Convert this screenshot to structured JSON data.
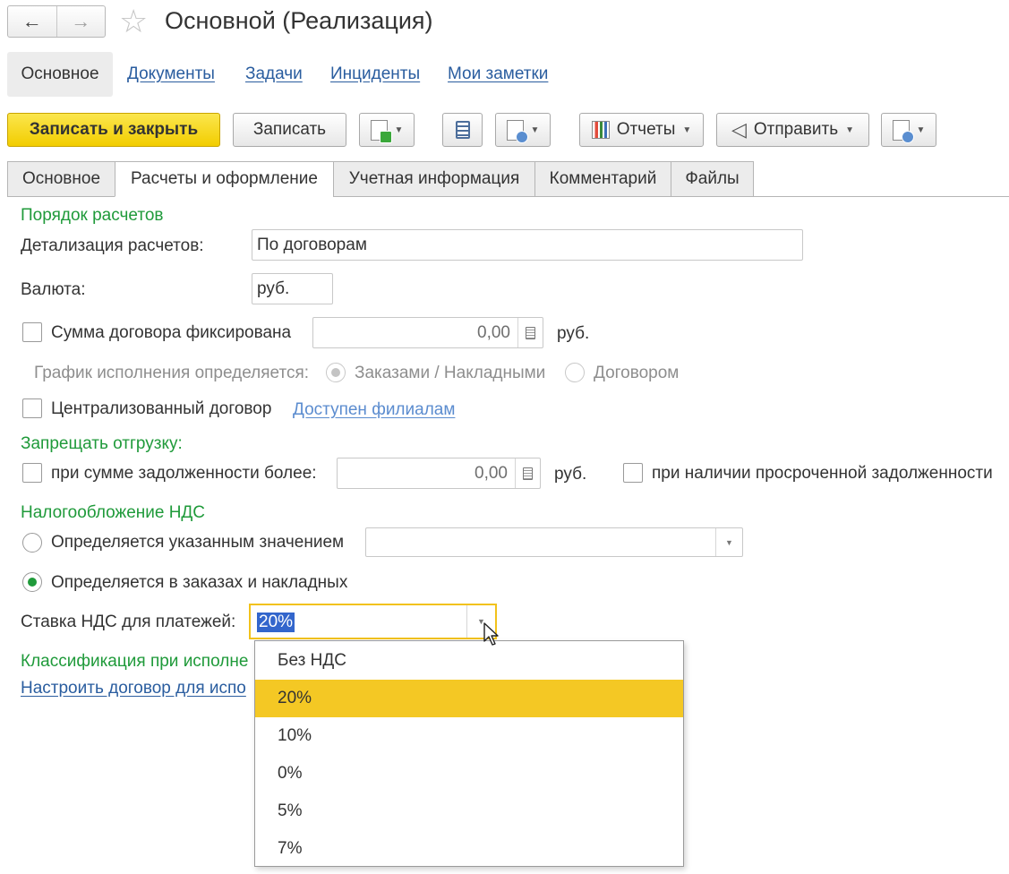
{
  "header": {
    "title": "Основной (Реализация)"
  },
  "sections": {
    "active": "Основное",
    "links": [
      "Документы",
      "Задачи",
      "Инциденты",
      "Мои заметки"
    ]
  },
  "toolbar": {
    "save_close": "Записать и закрыть",
    "save": "Записать",
    "reports": "Отчеты",
    "send": "Отправить"
  },
  "tabs": [
    "Основное",
    "Расчеты и оформление",
    "Учетная информация",
    "Комментарий",
    "Файлы"
  ],
  "form": {
    "settlement_order": "Порядок расчетов",
    "detail_label": "Детализация расчетов:",
    "detail_value": "По договорам",
    "currency_label": "Валюта:",
    "currency_value": "руб.",
    "fixed_sum_label": "Сумма договора фиксирована",
    "fixed_sum_value": "0,00",
    "fixed_sum_unit": "руб.",
    "schedule_label": "График исполнения определяется:",
    "schedule_opt1": "Заказами / Накладными",
    "schedule_opt2": "Договором",
    "centralized_label": "Централизованный договор",
    "branches_link": "Доступен филиалам",
    "forbid_shipment": "Запрещать отгрузку:",
    "debt_label": "при сумме задолженности более:",
    "debt_value": "0,00",
    "debt_unit": "руб.",
    "overdue_label": "при наличии просроченной задолженности",
    "vat_header": "Налогообложение НДС",
    "vat_opt1": "Определяется указанным значением",
    "vat_opt2": "Определяется в заказах и накладных",
    "vat_rate_label": "Ставка НДС для платежей:",
    "vat_rate_value": "20%",
    "classification": "Классификация при исполне",
    "configure_link": "Настроить договор для испо"
  },
  "vat_dropdown": {
    "options": [
      "Без НДС",
      "20%",
      "10%",
      "0%",
      "5%",
      "7%"
    ],
    "selected": "20%"
  },
  "colors": {
    "accent_yellow": "#f4c824",
    "section_green": "#1f9a3a",
    "link_blue": "#2a5d9f"
  }
}
